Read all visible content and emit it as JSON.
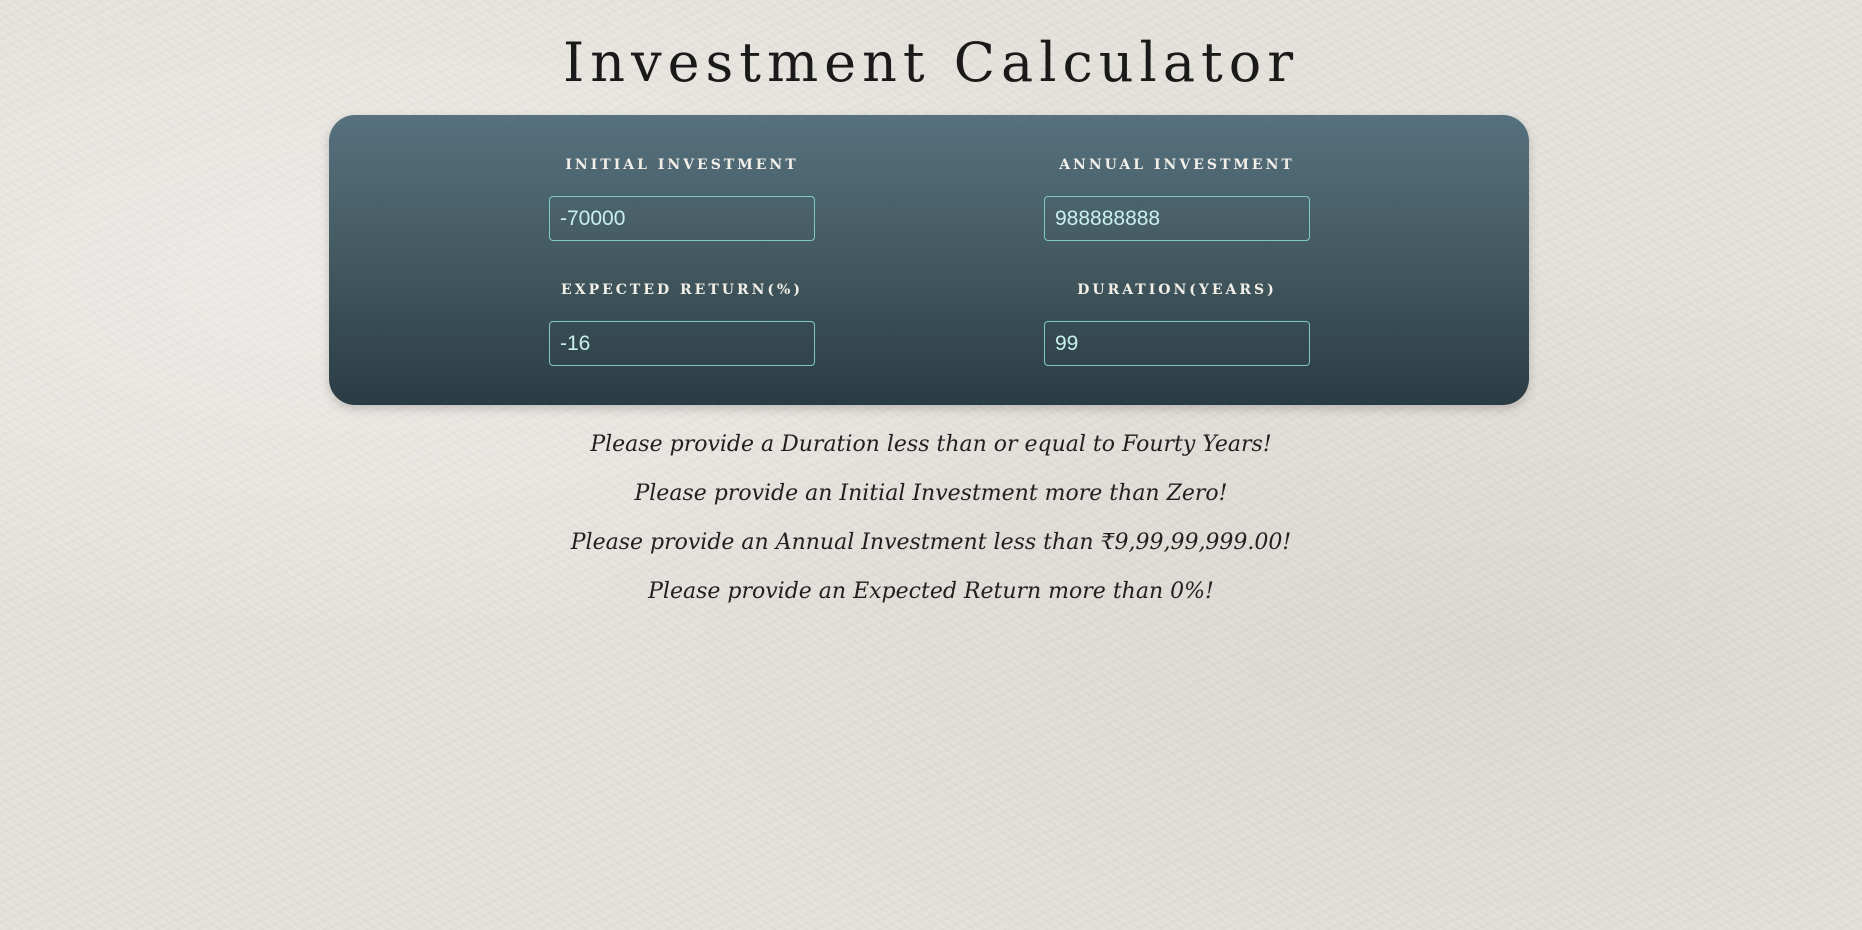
{
  "page": {
    "title": "Investment Calculator"
  },
  "form": {
    "initial_investment": {
      "label": "Initial Investment",
      "value": "-70000"
    },
    "annual_investment": {
      "label": "Annual Investment",
      "value": "988888888"
    },
    "expected_return": {
      "label": "Expected Return(%)",
      "value": "-16"
    },
    "duration": {
      "label": "Duration(Years)",
      "value": "99"
    }
  },
  "messages": [
    "Please provide a Duration less than or equal to Fourty Years!",
    "Please provide an Initial Investment more than Zero!",
    "Please provide an Annual Investment less than ₹9,99,99,999.00!",
    "Please provide an Expected Return more than 0%!"
  ],
  "colors": {
    "background": "#e6e2dc",
    "panel_top": "#56717f",
    "panel_bottom": "#2a3b44",
    "input_border": "#7fc9c4",
    "input_text": "#c8f0ec",
    "label_text": "#f1efe8"
  }
}
